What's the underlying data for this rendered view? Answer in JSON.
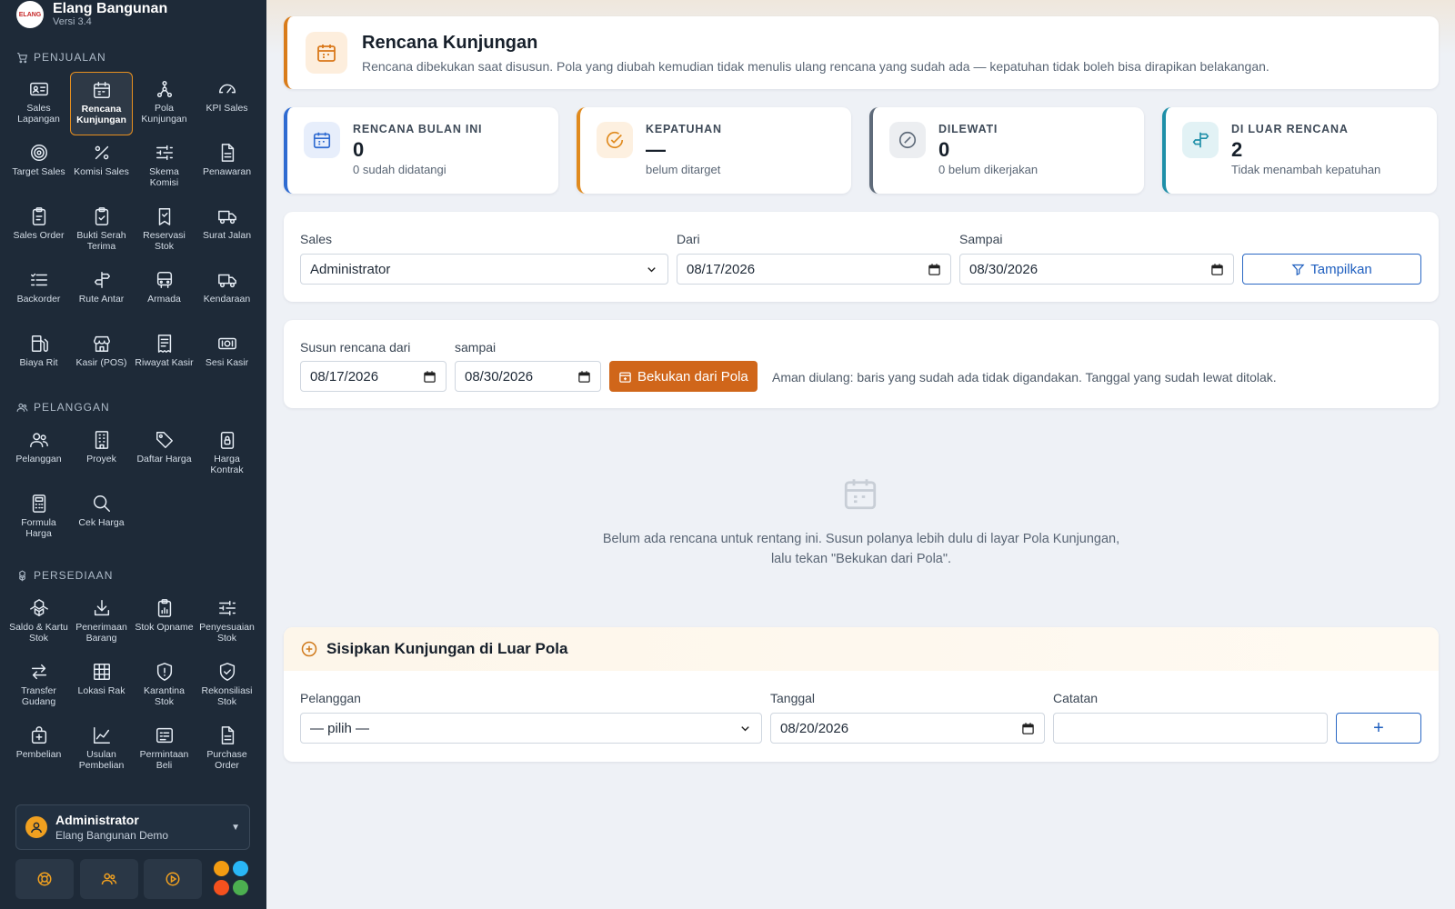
{
  "brand": {
    "name": "Elang Bangunan",
    "version": "Versi 3.4",
    "logo_text": "ELANG"
  },
  "sidebar": {
    "sections": [
      {
        "title": "PENJUALAN",
        "icon": "cart-icon",
        "items": [
          {
            "label": "Sales Lapangan",
            "icon": "id-card-icon"
          },
          {
            "label": "Rencana Kunjungan",
            "icon": "calendar-icon",
            "active": true
          },
          {
            "label": "Pola Kunjungan",
            "icon": "hierarchy-icon"
          },
          {
            "label": "KPI Sales",
            "icon": "gauge-icon"
          },
          {
            "label": "Target Sales",
            "icon": "target-icon"
          },
          {
            "label": "Komisi Sales",
            "icon": "percent-icon"
          },
          {
            "label": "Skema Komisi",
            "icon": "sliders-icon"
          },
          {
            "label": "Penawaran",
            "icon": "document-icon"
          },
          {
            "label": "Sales Order",
            "icon": "clipboard-icon"
          },
          {
            "label": "Bukti Serah Terima",
            "icon": "clipboard-check-icon"
          },
          {
            "label": "Reservasi Stok",
            "icon": "bookmark-icon"
          },
          {
            "label": "Surat Jalan",
            "icon": "truck-icon"
          },
          {
            "label": "Backorder",
            "icon": "list-icon"
          },
          {
            "label": "Rute Antar",
            "icon": "signpost-icon"
          },
          {
            "label": "Armada",
            "icon": "bus-icon"
          },
          {
            "label": "Kendaraan",
            "icon": "truck-icon"
          },
          {
            "label": "Biaya Rit",
            "icon": "fuel-icon"
          },
          {
            "label": "Kasir (POS)",
            "icon": "store-icon"
          },
          {
            "label": "Riwayat Kasir",
            "icon": "receipt-icon"
          },
          {
            "label": "Sesi Kasir",
            "icon": "cash-icon"
          }
        ]
      },
      {
        "title": "PELANGGAN",
        "icon": "users-icon",
        "items": [
          {
            "label": "Pelanggan",
            "icon": "users-icon"
          },
          {
            "label": "Proyek",
            "icon": "building-icon"
          },
          {
            "label": "Daftar Harga",
            "icon": "tag-icon"
          },
          {
            "label": "Harga Kontrak",
            "icon": "lock-icon"
          },
          {
            "label": "Formula Harga",
            "icon": "calculator-icon"
          },
          {
            "label": "Cek Harga",
            "icon": "search-icon"
          }
        ]
      },
      {
        "title": "PERSEDIAAN",
        "icon": "boxes-icon",
        "items": [
          {
            "label": "Saldo & Kartu Stok",
            "icon": "boxes-icon"
          },
          {
            "label": "Penerimaan Barang",
            "icon": "download-icon"
          },
          {
            "label": "Stok Opname",
            "icon": "clipboard-chart-icon"
          },
          {
            "label": "Penyesuaian Stok",
            "icon": "sliders-icon"
          },
          {
            "label": "Transfer Gudang",
            "icon": "transfer-icon"
          },
          {
            "label": "Lokasi Rak",
            "icon": "grid-icon"
          },
          {
            "label": "Karantina Stok",
            "icon": "shield-alert-icon"
          },
          {
            "label": "Rekonsiliasi Stok",
            "icon": "shield-check-icon"
          },
          {
            "label": "Pembelian",
            "icon": "bag-plus-icon"
          },
          {
            "label": "Usulan Pembelian",
            "icon": "trend-icon"
          },
          {
            "label": "Permintaan Beli",
            "icon": "form-icon"
          },
          {
            "label": "Purchase Order",
            "icon": "document-icon"
          }
        ]
      }
    ]
  },
  "user": {
    "name": "Administrator",
    "org": "Elang Bangunan Demo"
  },
  "bottom_buttons": [
    "lifebuoy-icon",
    "users-icon",
    "play-icon"
  ],
  "theme_colors": [
    "#f39c12",
    "#29b6f6",
    "#f4511e",
    "#4caf50"
  ],
  "header": {
    "title": "Rencana Kunjungan",
    "subtitle": "Rencana dibekukan saat disusun. Pola yang diubah kemudian tidak menulis ulang rencana yang sudah ada — kepatuhan tidak boleh bisa dirapikan belakangan."
  },
  "stats": [
    {
      "label": "RENCANA BULAN INI",
      "value": "0",
      "note": "0 sudah didatangi",
      "color": "#2f6bd1",
      "icon": "calendar-icon"
    },
    {
      "label": "KEPATUHAN",
      "value": "—",
      "note": "belum ditarget",
      "color": "#e08a1e",
      "icon": "check-circle-icon"
    },
    {
      "label": "DILEWATI",
      "value": "0",
      "note": "0 belum dikerjakan",
      "color": "#5f6b7a",
      "icon": "slash-circle-icon"
    },
    {
      "label": "DI LUAR RENCANA",
      "value": "2",
      "note": "Tidak menambah kepatuhan",
      "color": "#1e8fa8",
      "icon": "signpost-icon"
    }
  ],
  "filter": {
    "sales_label": "Sales",
    "sales_value": "Administrator",
    "from_label": "Dari",
    "from_value": "08/17/2026",
    "to_label": "Sampai",
    "to_value": "08/30/2026",
    "show_button": "Tampilkan"
  },
  "compose": {
    "from_label": "Susun rencana dari",
    "from_value": "08/17/2026",
    "to_label": "sampai",
    "to_value": "08/30/2026",
    "button": "Bekukan dari Pola",
    "hint": "Aman diulang: baris yang sudah ada tidak digandakan. Tanggal yang sudah lewat ditolak."
  },
  "empty": {
    "line1": "Belum ada rencana untuk rentang ini. Susun polanya lebih dulu di layar Pola Kunjungan,",
    "line2": "lalu tekan \"Bekukan dari Pola\"."
  },
  "insert": {
    "title": "Sisipkan Kunjungan di Luar Pola",
    "customer_label": "Pelanggan",
    "customer_value": "— pilih —",
    "date_label": "Tanggal",
    "date_value": "08/20/2026",
    "note_label": "Catatan",
    "note_value": "",
    "add_button": "+"
  }
}
